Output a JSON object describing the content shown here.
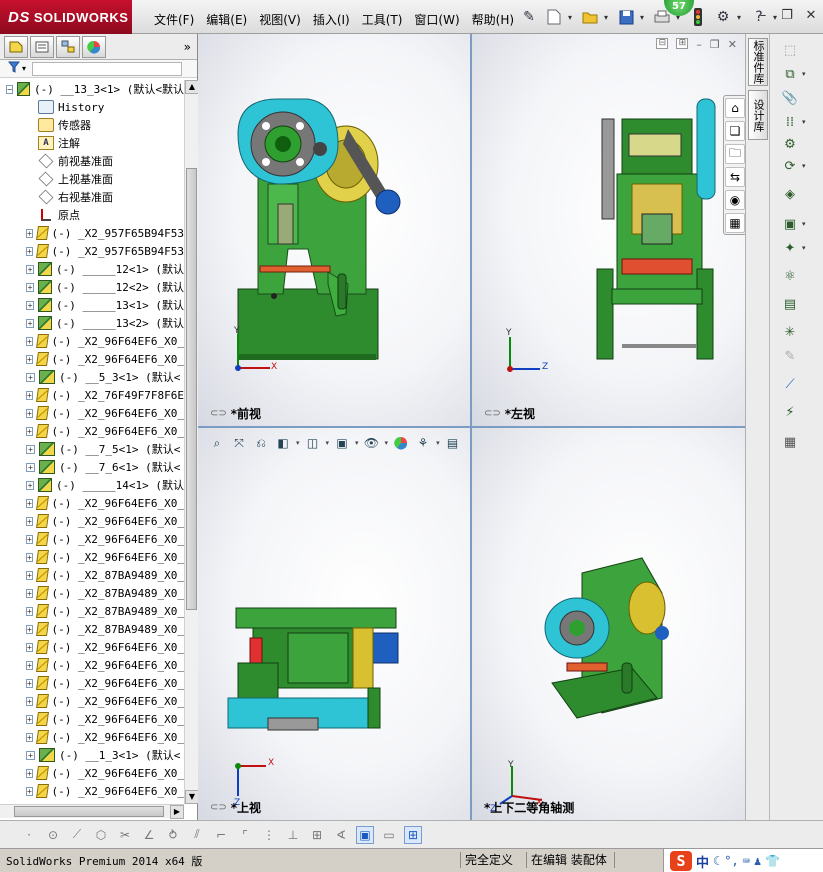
{
  "app": {
    "logo_prefix": "DS",
    "logo_text": "SOLIDWORKS",
    "notification_count": "57"
  },
  "menu": [
    "文件(F)",
    "编辑(E)",
    "视图(V)",
    "插入(I)",
    "工具(T)",
    "窗口(W)",
    "帮助(H)"
  ],
  "toolbar_icons": [
    "pin-icon",
    "new-document-icon",
    "open-folder-icon",
    "save-icon",
    "print-icon",
    "traffic-light-icon",
    "options-icon",
    "help-icon"
  ],
  "panel": {
    "tabs": [
      "feature-manager-icon",
      "property-manager-icon",
      "configuration-manager-icon",
      "appearance-manager-icon"
    ],
    "more": "»",
    "filter_icon": "filter-icon"
  },
  "tree": {
    "root": "(-) __13_3<1> (默认<默认",
    "fixed_items": [
      {
        "icon": "hist",
        "name": "history-icon",
        "label": "History"
      },
      {
        "icon": "sensor",
        "name": "sensor-icon",
        "label": "传感器"
      },
      {
        "icon": "note",
        "name": "annotation-icon",
        "label": "注解"
      },
      {
        "icon": "plane",
        "name": "plane-icon",
        "label": "前视基准面"
      },
      {
        "icon": "plane",
        "name": "plane-icon",
        "label": "上视基准面"
      },
      {
        "icon": "plane",
        "name": "plane-icon",
        "label": "右视基准面"
      },
      {
        "icon": "origin",
        "name": "origin-icon",
        "label": "原点"
      }
    ],
    "components": [
      {
        "type": "part",
        "label": "(-) _X2_957F65B94F53"
      },
      {
        "type": "part",
        "label": "(-) _X2_957F65B94F53"
      },
      {
        "type": "asm",
        "label": "(-) _____12<1> (默认"
      },
      {
        "type": "asm",
        "label": "(-) _____12<2> (默认"
      },
      {
        "type": "asm",
        "label": "(-) _____13<1> (默认"
      },
      {
        "type": "asm",
        "label": "(-) _____13<2> (默认"
      },
      {
        "type": "part",
        "label": "(-) _X2_96F64EF6_X0_"
      },
      {
        "type": "part",
        "label": "(-) _X2_96F64EF6_X0_"
      },
      {
        "type": "asm",
        "label": "(-) __5_3<1> (默认<"
      },
      {
        "type": "part",
        "label": "(-) _X2_76F49F7F8F6E"
      },
      {
        "type": "part",
        "label": "(-) _X2_96F64EF6_X0_"
      },
      {
        "type": "part",
        "label": "(-) _X2_96F64EF6_X0_"
      },
      {
        "type": "asm",
        "label": "(-) __7_5<1> (默认<"
      },
      {
        "type": "asm",
        "label": "(-) __7_6<1> (默认<"
      },
      {
        "type": "asm",
        "label": "(-) _____14<1> (默认"
      },
      {
        "type": "part",
        "label": "(-) _X2_96F64EF6_X0_"
      },
      {
        "type": "part",
        "label": "(-) _X2_96F64EF6_X0_"
      },
      {
        "type": "part",
        "label": "(-) _X2_96F64EF6_X0_"
      },
      {
        "type": "part",
        "label": "(-) _X2_96F64EF6_X0_"
      },
      {
        "type": "part",
        "label": "(-) _X2_87BA9489_X0_"
      },
      {
        "type": "part",
        "label": "(-) _X2_87BA9489_X0_"
      },
      {
        "type": "part",
        "label": "(-) _X2_87BA9489_X0_"
      },
      {
        "type": "part",
        "label": "(-) _X2_87BA9489_X0_"
      },
      {
        "type": "part",
        "label": "(-) _X2_96F64EF6_X0_"
      },
      {
        "type": "part",
        "label": "(-) _X2_96F64EF6_X0_"
      },
      {
        "type": "part",
        "label": "(-) _X2_96F64EF6_X0_"
      },
      {
        "type": "part",
        "label": "(-) _X2_96F64EF6_X0_"
      },
      {
        "type": "part",
        "label": "(-) _X2_96F64EF6_X0_"
      },
      {
        "type": "part",
        "label": "(-) _X2_96F64EF6_X0_"
      },
      {
        "type": "asm",
        "label": "(-) __1_3<1> (默认<"
      },
      {
        "type": "part",
        "label": "(-) _X2_96F64EF6_X0_"
      },
      {
        "type": "part",
        "label": "(-) _X2_96F64EF6_X0_"
      }
    ]
  },
  "viewports": {
    "front": "*前视",
    "left": "*左视",
    "top": "*上视",
    "iso": "*上下二等角轴测"
  },
  "triad_labels": {
    "x": "X",
    "y": "Y",
    "z": "Z"
  },
  "taskpane": {
    "tab1": "标准件库",
    "tab2": "设计库"
  },
  "status": {
    "app": "SolidWorks Premium 2014 x64 版",
    "definition": "完全定义",
    "mode": "在编辑 装配体"
  },
  "ime": {
    "text": "中"
  },
  "colors": {
    "frame_green": "#2e8b2e",
    "flywheel_cyan": "#2ec4d6",
    "accent_red": "#c8102e",
    "motor_blue": "#1f5fbf",
    "pulley_yellow": "#d8c030"
  }
}
